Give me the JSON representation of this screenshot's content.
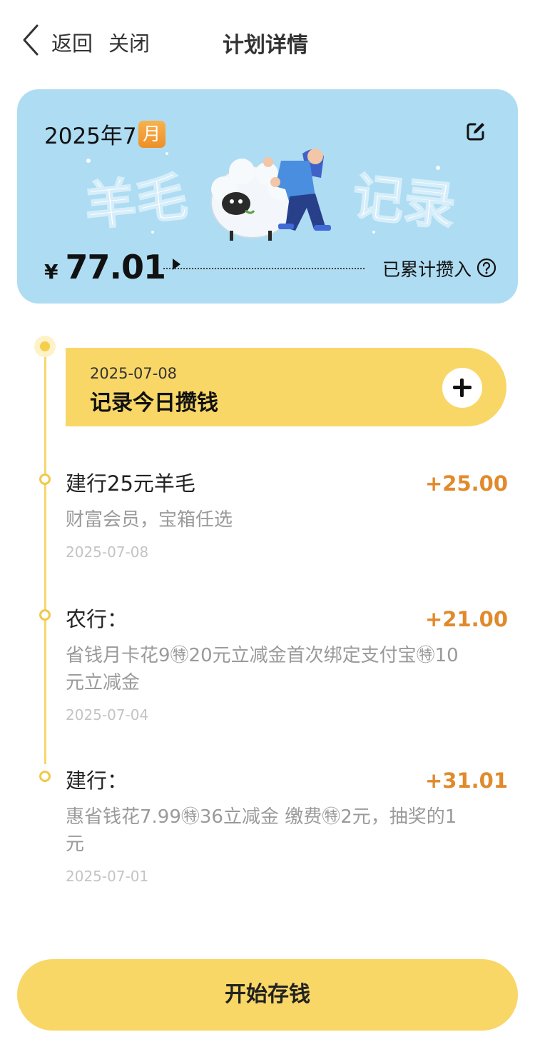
{
  "nav": {
    "back_label": "返回",
    "close_label": "关闭",
    "title": "计划详情"
  },
  "hero": {
    "year_month": "2025年7",
    "month_badge": "月",
    "banner_text_left": "羊毛",
    "banner_text_right": "记录",
    "currency": "¥",
    "amount": "77.01",
    "total_label": "已累计攒入",
    "colors": {
      "card_bg": "#aedcf2"
    }
  },
  "record_today": {
    "date": "2025-07-08",
    "label": "记录今日攒钱"
  },
  "entries": [
    {
      "title": "建行25元羊毛",
      "amount": "+25.00",
      "desc": "财富会员，宝箱任选",
      "date": "2025-07-08"
    },
    {
      "title": "农行：",
      "amount": "+21.00",
      "desc": "省钱月卡花9㊕20元立减金首次绑定支付宝㊕10元立减金",
      "date": "2025-07-04"
    },
    {
      "title": "建行：",
      "amount": "+31.01",
      "desc": "惠省钱花7.99㊕36立减金 缴费㊕2元，抽奖的1元",
      "date": "2025-07-01"
    }
  ],
  "footer": {
    "start_button": "开始存钱"
  },
  "colors": {
    "accent_yellow": "#f8d767",
    "amount_orange": "#e08a2c"
  }
}
